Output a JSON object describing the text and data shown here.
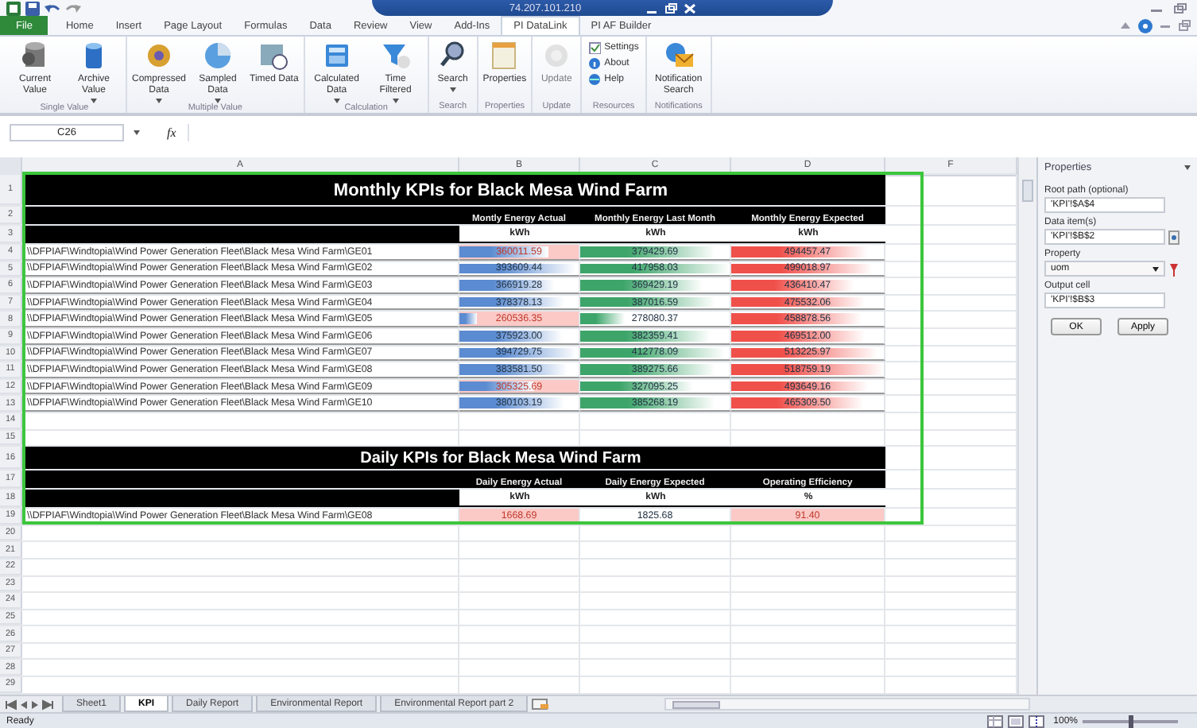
{
  "window": {
    "title": "74.207.101.210"
  },
  "ribbon_tabs": [
    {
      "label": "File",
      "kind": "file",
      "selected": false
    },
    {
      "label": "Home",
      "kind": "tab",
      "selected": false
    },
    {
      "label": "Insert",
      "kind": "tab",
      "selected": false
    },
    {
      "label": "Page Layout",
      "kind": "tab",
      "selected": false
    },
    {
      "label": "Formulas",
      "kind": "tab",
      "selected": false
    },
    {
      "label": "Data",
      "kind": "tab",
      "selected": false
    },
    {
      "label": "Review",
      "kind": "tab",
      "selected": false
    },
    {
      "label": "View",
      "kind": "tab",
      "selected": false
    },
    {
      "label": "Add-Ins",
      "kind": "tab",
      "selected": false
    },
    {
      "label": "PI DataLink",
      "kind": "tab",
      "selected": true
    },
    {
      "label": "PI AF Builder",
      "kind": "tab",
      "selected": false
    }
  ],
  "ribbon_groups": [
    {
      "label": "Single Value",
      "buttons": [
        {
          "label": "Current Value",
          "kind": "large",
          "dropdown": false,
          "disabled": false
        },
        {
          "label": "Archive Value",
          "kind": "large",
          "dropdown": true,
          "disabled": false
        }
      ]
    },
    {
      "label": "Multiple Value",
      "buttons": [
        {
          "label": "Compressed Data",
          "kind": "large",
          "dropdown": true,
          "disabled": false
        },
        {
          "label": "Sampled Data",
          "kind": "large",
          "dropdown": true,
          "disabled": false
        },
        {
          "label": "Timed Data",
          "kind": "large",
          "dropdown": false,
          "disabled": false
        }
      ]
    },
    {
      "label": "Calculation",
      "buttons": [
        {
          "label": "Calculated Data",
          "kind": "large",
          "dropdown": true,
          "disabled": false
        },
        {
          "label": "Time Filtered",
          "kind": "large",
          "dropdown": true,
          "disabled": false
        }
      ]
    },
    {
      "label": "Search",
      "buttons": [
        {
          "label": "Search",
          "kind": "large",
          "dropdown": true,
          "disabled": false
        }
      ]
    },
    {
      "label": "Properties",
      "buttons": [
        {
          "label": "Properties",
          "kind": "large",
          "dropdown": false,
          "disabled": false
        }
      ]
    },
    {
      "label": "Update",
      "buttons": [
        {
          "label": "Update",
          "kind": "large",
          "dropdown": false,
          "disabled": true
        }
      ]
    },
    {
      "label": "Resources",
      "buttons": [
        {
          "label": "Settings",
          "kind": "small",
          "dropdown": false,
          "disabled": false
        },
        {
          "label": "About",
          "kind": "small",
          "dropdown": false,
          "disabled": false
        },
        {
          "label": "Help",
          "kind": "small",
          "dropdown": false,
          "disabled": false
        }
      ]
    },
    {
      "label": "Notifications",
      "buttons": [
        {
          "label": "Notification Search",
          "kind": "large",
          "dropdown": false,
          "disabled": false
        }
      ]
    }
  ],
  "formula_bar": {
    "name_box": "C26",
    "function_label": "fx"
  },
  "sheet": {
    "column_headers": [
      "A",
      "B",
      "C",
      "D",
      "F"
    ],
    "row_numbers": [
      "1",
      "2",
      "3",
      "4",
      "5",
      "6",
      "7",
      "8",
      "9",
      "10",
      "11",
      "12",
      "13",
      "14",
      "15",
      "16",
      "17",
      "18",
      "19",
      "20",
      "21",
      "22",
      "23",
      "24",
      "25",
      "26",
      "27",
      "28",
      "29"
    ],
    "monthly": {
      "title": "Monthly KPIs for Black Mesa Wind Farm",
      "columns": [
        {
          "header": "Montly Energy Actual",
          "unit": "kWh",
          "color": "#5b8bd0"
        },
        {
          "header": "Monthly Energy Last Month",
          "unit": "kWh",
          "color": "#3ea56a"
        },
        {
          "header": "Monthly Energy Expected",
          "unit": "kWh",
          "color": "#f0504a"
        }
      ],
      "rows": [
        {
          "path": "\\\\DFPIAF\\Windtopia\\Wind Power Generation Fleet\\Black Mesa Wind Farm\\GE01",
          "cells": [
            {
              "value": "360011.59",
              "level": 0.75,
              "highlight": true
            },
            {
              "value": "379429.69",
              "level": 0.9,
              "highlight": false
            },
            {
              "value": "494457.47",
              "level": 0.9,
              "highlight": false
            }
          ]
        },
        {
          "path": "\\\\DFPIAF\\Windtopia\\Wind Power Generation Fleet\\Black Mesa Wind Farm\\GE02",
          "cells": [
            {
              "value": "393609.44",
              "level": 0.97,
              "highlight": false
            },
            {
              "value": "417958.03",
              "level": 1.0,
              "highlight": false
            },
            {
              "value": "499018.97",
              "level": 0.93,
              "highlight": false
            }
          ]
        },
        {
          "path": "\\\\DFPIAF\\Windtopia\\Wind Power Generation Fleet\\Black Mesa Wind Farm\\GE03",
          "cells": [
            {
              "value": "366919.28",
              "level": 0.8,
              "highlight": false
            },
            {
              "value": "369429.19",
              "level": 0.82,
              "highlight": false
            },
            {
              "value": "436410.47",
              "level": 0.8,
              "highlight": false
            }
          ]
        },
        {
          "path": "\\\\DFPIAF\\Windtopia\\Wind Power Generation Fleet\\Black Mesa Wind Farm\\GE04",
          "cells": [
            {
              "value": "378378.13",
              "level": 0.88,
              "highlight": false
            },
            {
              "value": "387016.59",
              "level": 0.9,
              "highlight": false
            },
            {
              "value": "475532.06",
              "level": 0.88,
              "highlight": false
            }
          ]
        },
        {
          "path": "\\\\DFPIAF\\Windtopia\\Wind Power Generation Fleet\\Black Mesa Wind Farm\\GE05",
          "cells": [
            {
              "value": "260536.35",
              "level": 0.15,
              "highlight": true
            },
            {
              "value": "278080.37",
              "level": 0.3,
              "highlight": false
            },
            {
              "value": "458878.56",
              "level": 0.85,
              "highlight": false
            }
          ]
        },
        {
          "path": "\\\\DFPIAF\\Windtopia\\Wind Power Generation Fleet\\Black Mesa Wind Farm\\GE06",
          "cells": [
            {
              "value": "375923.00",
              "level": 0.86,
              "highlight": false
            },
            {
              "value": "382359.41",
              "level": 0.87,
              "highlight": false
            },
            {
              "value": "469512.00",
              "level": 0.87,
              "highlight": false
            }
          ]
        },
        {
          "path": "\\\\DFPIAF\\Windtopia\\Wind Power Generation Fleet\\Black Mesa Wind Farm\\GE07",
          "cells": [
            {
              "value": "394729.75",
              "level": 0.98,
              "highlight": false
            },
            {
              "value": "412778.09",
              "level": 0.97,
              "highlight": false
            },
            {
              "value": "513225.97",
              "level": 0.96,
              "highlight": false
            }
          ]
        },
        {
          "path": "\\\\DFPIAF\\Windtopia\\Wind Power Generation Fleet\\Black Mesa Wind Farm\\GE08",
          "cells": [
            {
              "value": "383581.50",
              "level": 0.9,
              "highlight": false
            },
            {
              "value": "389275.66",
              "level": 0.9,
              "highlight": false
            },
            {
              "value": "518759.19",
              "level": 1.0,
              "highlight": false
            }
          ]
        },
        {
          "path": "\\\\DFPIAF\\Windtopia\\Wind Power Generation Fleet\\Black Mesa Wind Farm\\GE09",
          "cells": [
            {
              "value": "305325.69",
              "level": 0.62,
              "highlight": true
            },
            {
              "value": "327095.25",
              "level": 0.75,
              "highlight": false
            },
            {
              "value": "493649.16",
              "level": 0.9,
              "highlight": false
            }
          ]
        },
        {
          "path": "\\\\DFPIAF\\Windtopia\\Wind Power Generation Fleet\\Black Mesa Wind Farm\\GE10",
          "cells": [
            {
              "value": "380103.19",
              "level": 0.88,
              "highlight": false
            },
            {
              "value": "385268.19",
              "level": 0.9,
              "highlight": false
            },
            {
              "value": "465309.50",
              "level": 0.86,
              "highlight": false
            }
          ]
        }
      ]
    },
    "daily": {
      "title": "Daily KPIs for Black Mesa Wind Farm",
      "columns": [
        {
          "header": "Daily Energy Actual",
          "unit": "kWh"
        },
        {
          "header": "Daily Energy Expected",
          "unit": "kWh"
        },
        {
          "header": "Operating Efficiency",
          "unit": "%"
        }
      ],
      "rows": [
        {
          "path": "\\\\DFPIAF\\Windtopia\\Wind Power Generation Fleet\\Black Mesa Wind Farm\\GE08",
          "cells": [
            {
              "value": "1668.69",
              "highlight": true
            },
            {
              "value": "1825.68",
              "highlight": false
            },
            {
              "value": "91.40",
              "highlight": true
            }
          ]
        }
      ]
    }
  },
  "sheet_tabs": [
    {
      "label": "Sheet1",
      "selected": false
    },
    {
      "label": "KPI",
      "selected": true
    },
    {
      "label": "Daily Report",
      "selected": false
    },
    {
      "label": "Environmental Report",
      "selected": false
    },
    {
      "label": "Environmental Report part 2",
      "selected": false
    }
  ],
  "properties_panel": {
    "title": "Properties",
    "fields": [
      {
        "label": "Root path (optional)",
        "value": "'KPI'!$A$4",
        "kind": "text"
      },
      {
        "label": "Data item(s)",
        "value": "'KPI'!$B$2",
        "kind": "picker"
      },
      {
        "label": "Property",
        "value": "uom",
        "kind": "select"
      },
      {
        "label": "Output cell",
        "value": "'KPI'!$B$3",
        "kind": "text"
      }
    ],
    "buttons": [
      "OK",
      "Apply"
    ]
  },
  "status_bar": {
    "text": "Ready",
    "zoom": "100%",
    "zoom_slider": {
      "level": 0.5
    }
  }
}
